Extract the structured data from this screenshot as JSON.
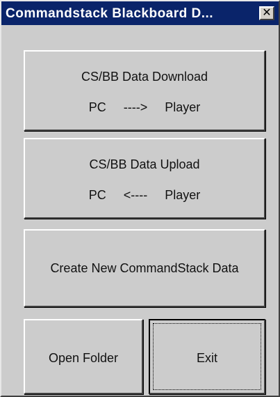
{
  "window": {
    "title": "Commandstack Blackboard D...",
    "close_symbol": "✕",
    "close_icon": "close-icon"
  },
  "buttons": {
    "download": {
      "line1": "CS/BB Data Download",
      "line2": "PC     ---->     Player"
    },
    "upload": {
      "line1": "CS/BB Data Upload",
      "line2": "PC     <----     Player"
    },
    "create": {
      "label": "Create New CommandStack Data"
    },
    "open_folder": {
      "label": "Open Folder"
    },
    "exit": {
      "label": "Exit",
      "focused": true
    }
  },
  "colors": {
    "titlebar": "#0a246a",
    "face": "#cccccc"
  }
}
